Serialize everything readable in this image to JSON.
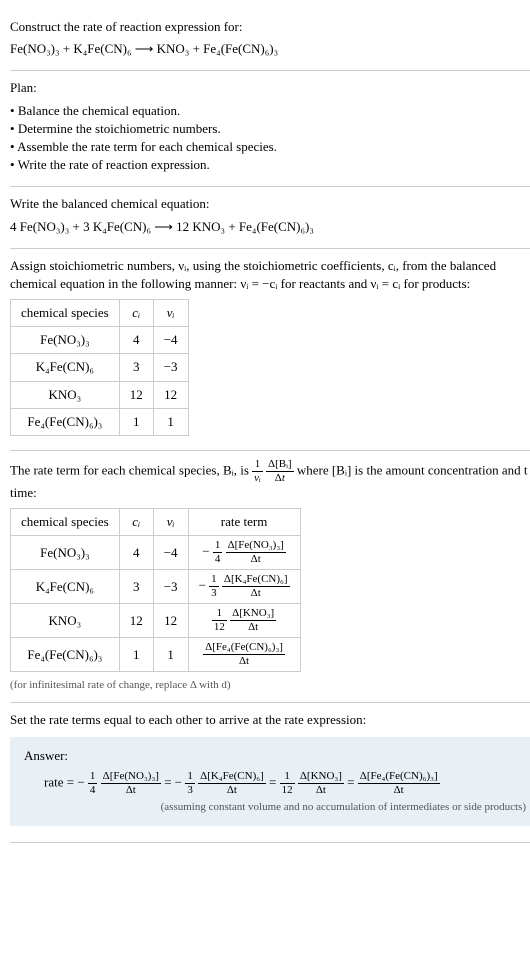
{
  "prompt": {
    "title": "Construct the rate of reaction expression for:",
    "equation": "Fe(NO₃)₃ + K₄Fe(CN)₆ ⟶ KNO₃ + Fe₄(Fe(CN)₆)₃"
  },
  "plan": {
    "title": "Plan:",
    "items": [
      "Balance the chemical equation.",
      "Determine the stoichiometric numbers.",
      "Assemble the rate term for each chemical species.",
      "Write the rate of reaction expression."
    ]
  },
  "balanced": {
    "title": "Write the balanced chemical equation:",
    "equation": "4 Fe(NO₃)₃ + 3 K₄Fe(CN)₆ ⟶ 12 KNO₃ + Fe₄(Fe(CN)₆)₃"
  },
  "stoich": {
    "text": "Assign stoichiometric numbers, νᵢ, using the stoichiometric coefficients, cᵢ, from the balanced chemical equation in the following manner: νᵢ = −cᵢ for reactants and νᵢ = cᵢ for products:",
    "headers": [
      "chemical species",
      "cᵢ",
      "νᵢ"
    ],
    "rows": [
      {
        "species": "Fe(NO₃)₃",
        "c": "4",
        "v": "−4"
      },
      {
        "species": "K₄Fe(CN)₆",
        "c": "3",
        "v": "−3"
      },
      {
        "species": "KNO₃",
        "c": "12",
        "v": "12"
      },
      {
        "species": "Fe₄(Fe(CN)₆)₃",
        "c": "1",
        "v": "1"
      }
    ]
  },
  "rateterm": {
    "text_pre": "The rate term for each chemical species, Bᵢ, is ",
    "text_post": " where [Bᵢ] is the amount concentration and t is time:",
    "headers": [
      "chemical species",
      "cᵢ",
      "νᵢ",
      "rate term"
    ],
    "rows": [
      {
        "species": "Fe(NO₃)₃",
        "c": "4",
        "v": "−4",
        "coef": "− ¼",
        "num": "Δ[Fe(NO₃)₃]"
      },
      {
        "species": "K₄Fe(CN)₆",
        "c": "3",
        "v": "−3",
        "coef": "− ⅓",
        "num": "Δ[K₄Fe(CN)₆]"
      },
      {
        "species": "KNO₃",
        "c": "12",
        "v": "12",
        "coef": "1/12",
        "num": "Δ[KNO₃]"
      },
      {
        "species": "Fe₄(Fe(CN)₆)₃",
        "c": "1",
        "v": "1",
        "coef": "",
        "num": "Δ[Fe₄(Fe(CN)₆)₃]"
      }
    ],
    "note": "(for infinitesimal rate of change, replace Δ with d)"
  },
  "final": {
    "text": "Set the rate terms equal to each other to arrive at the rate expression:",
    "answer_label": "Answer:",
    "rate_prefix": "rate = ",
    "note": "(assuming constant volume and no accumulation of intermediates or side products)"
  },
  "delta_t": "Δt"
}
